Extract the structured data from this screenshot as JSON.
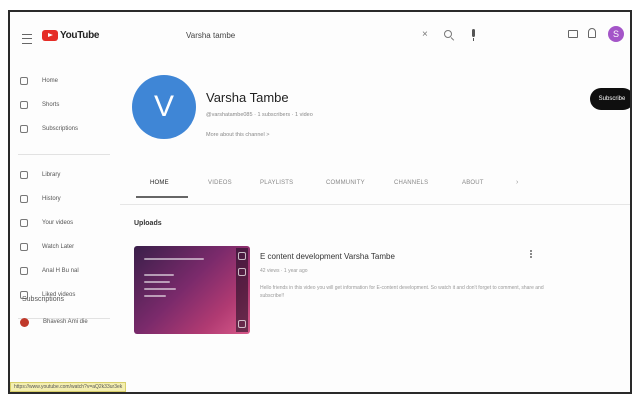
{
  "header": {
    "logo_text": "YouTube",
    "search_value": "Varsha tambe",
    "clear_glyph": "×",
    "avatar_letter": "S"
  },
  "sidebar": {
    "items": [
      {
        "label": "Home",
        "icon": "home-icon"
      },
      {
        "label": "Shorts",
        "icon": "shorts-icon"
      },
      {
        "label": "Subscriptions",
        "icon": "subscriptions-icon"
      },
      {
        "label": "Library",
        "icon": "library-icon"
      },
      {
        "label": "History",
        "icon": "history-icon"
      },
      {
        "label": "Your videos",
        "icon": "your-videos-icon"
      },
      {
        "label": "Watch Later",
        "icon": "watch-later-icon"
      },
      {
        "label": "Anal H Bu nal",
        "icon": "playlist-icon"
      },
      {
        "label": "Liked videos",
        "icon": "liked-icon"
      }
    ],
    "subscriptions_title": "Subscriptions",
    "subscription_first": "Bhavesh Ami die"
  },
  "channel": {
    "avatar_letter": "V",
    "name": "Varsha Tambe",
    "meta": "@varshatambe085 · 1 subscribers · 1 video",
    "more": "More about this channel  >",
    "subscribe_label": "Subscribe"
  },
  "tabs": [
    {
      "label": "HOME",
      "active": true
    },
    {
      "label": "VIDEOS",
      "active": false
    },
    {
      "label": "PLAYLISTS",
      "active": false
    },
    {
      "label": "COMMUNITY",
      "active": false
    },
    {
      "label": "CHANNELS",
      "active": false
    },
    {
      "label": "ABOUT",
      "active": false
    }
  ],
  "uploads": {
    "title": "Uploads",
    "video": {
      "title": "E content development Varsha Tambe",
      "meta": "42 views · 1 year ago",
      "description": "Hello friends in this video you will get information for E-content development. So watch it and don't forget to comment, share and subscribe!!"
    }
  },
  "status_url": "https://www.youtube.com/watch?v=aQ2k33ur3ek"
}
